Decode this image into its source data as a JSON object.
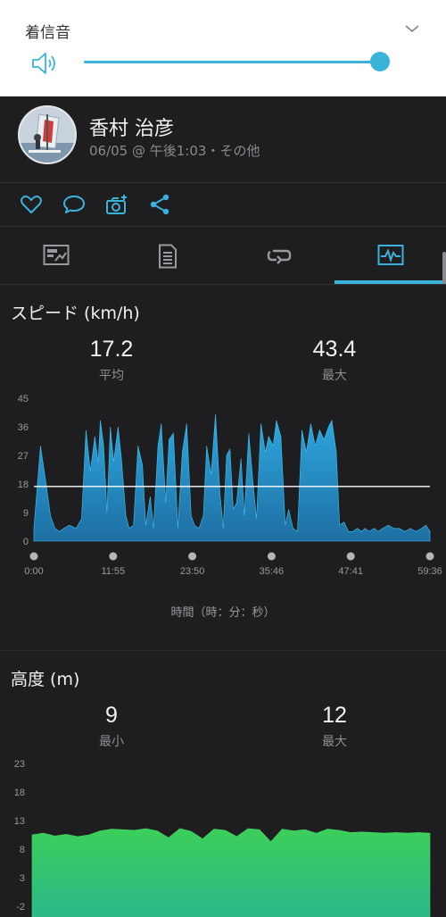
{
  "volume": {
    "title": "着信音",
    "level": 0.96
  },
  "activity": {
    "user_name": "香村 治彦",
    "meta": "06/05 @ 午後1:03・その他"
  },
  "colors": {
    "accent": "#3ab3da",
    "speed_fill_top": "#2ea8e0",
    "speed_fill_bottom": "#1e6fa3",
    "elevation_fill_top": "#3ccf5a",
    "elevation_fill_bottom": "#2ab88a",
    "average_line": "#ffffff"
  },
  "icons": {
    "actions": [
      "heart-icon",
      "comment-icon",
      "add-photo-icon",
      "share-icon"
    ],
    "tabs": [
      "summary-tab-icon",
      "details-tab-icon",
      "laps-tab-icon",
      "charts-tab-icon"
    ],
    "active_tab": 3
  },
  "speed": {
    "title": "スピード (km/h)",
    "avg_value": "17.2",
    "avg_label": "平均",
    "max_value": "43.4",
    "max_label": "最大",
    "x_caption": "時間（時：分：秒）"
  },
  "elevation": {
    "title": "高度 (m)",
    "min_value": "9",
    "min_label": "最小",
    "max_value": "12",
    "max_label": "最大"
  },
  "chart_data": [
    {
      "type": "area",
      "title": "スピード (km/h)",
      "xlabel": "時間（時：分：秒）",
      "ylabel": "",
      "y_ticks": [
        "45",
        "36",
        "27",
        "18",
        "9",
        "0"
      ],
      "ylim": [
        0,
        45
      ],
      "x_ticks": [
        "0:00",
        "11:55",
        "23:50",
        "35:46",
        "47:41",
        "59:36"
      ],
      "xlim_seconds": [
        0,
        3576
      ],
      "average": 17.2,
      "series": [
        {
          "x_seconds": [
            0,
            60,
            110,
            150,
            190,
            230,
            270,
            320,
            380,
            430,
            470,
            510,
            550,
            580,
            600,
            630,
            660,
            690,
            720,
            760,
            790,
            830,
            860,
            900,
            940,
            980,
            1010,
            1050,
            1080,
            1120,
            1150,
            1190,
            1220,
            1260,
            1300,
            1340,
            1380,
            1420,
            1450,
            1490,
            1530,
            1560,
            1600,
            1640,
            1680,
            1710,
            1740,
            1770,
            1800,
            1830,
            1870,
            1900,
            1940,
            1980,
            2010,
            2050,
            2090,
            2120,
            2160,
            2190,
            2230,
            2270,
            2300,
            2340,
            2380,
            2420,
            2460,
            2500,
            2540,
            2580,
            2620,
            2660,
            2690,
            2730,
            2760,
            2800,
            2840,
            2880,
            2920,
            2960,
            2990,
            3030,
            3070,
            3110,
            3150,
            3200,
            3250,
            3300,
            3350,
            3400,
            3450,
            3500,
            3540,
            3576
          ],
          "values": [
            4,
            30,
            18,
            8,
            4,
            3,
            4,
            5,
            4,
            7,
            35,
            22,
            33,
            25,
            38,
            30,
            9,
            36,
            25,
            36,
            26,
            8,
            4,
            5,
            30,
            24,
            5,
            14,
            4,
            30,
            37,
            12,
            32,
            34,
            4,
            28,
            37,
            8,
            5,
            4,
            8,
            30,
            21,
            40,
            15,
            4,
            27,
            29,
            10,
            12,
            26,
            8,
            34,
            18,
            7,
            37,
            28,
            33,
            30,
            38,
            33,
            5,
            10,
            4,
            3,
            35,
            28,
            37,
            30,
            35,
            32,
            36,
            38,
            28,
            5,
            6,
            3,
            3,
            4,
            3,
            4,
            3,
            4,
            3,
            4,
            5,
            4,
            4,
            3,
            4,
            3,
            4,
            5,
            3
          ]
        }
      ]
    },
    {
      "type": "area",
      "title": "高度 (m)",
      "y_ticks": [
        "23",
        "18",
        "13",
        "8",
        "3",
        "-2"
      ],
      "ylim": [
        -2,
        23
      ],
      "series": [
        {
          "values": [
            10.5,
            10.8,
            10.3,
            10.6,
            10.2,
            10.5,
            11.2,
            11.5,
            11.4,
            11.3,
            11.6,
            11.2,
            10.0,
            11.6,
            11.1,
            9.8,
            11.5,
            11.3,
            10.2,
            11.6,
            11.4,
            9.3,
            11.5,
            11.2,
            11.4,
            10.8,
            11.5,
            11.3,
            10.9,
            11.0,
            10.9,
            10.8,
            10.9,
            10.8,
            10.9,
            10.8
          ]
        }
      ]
    }
  ]
}
